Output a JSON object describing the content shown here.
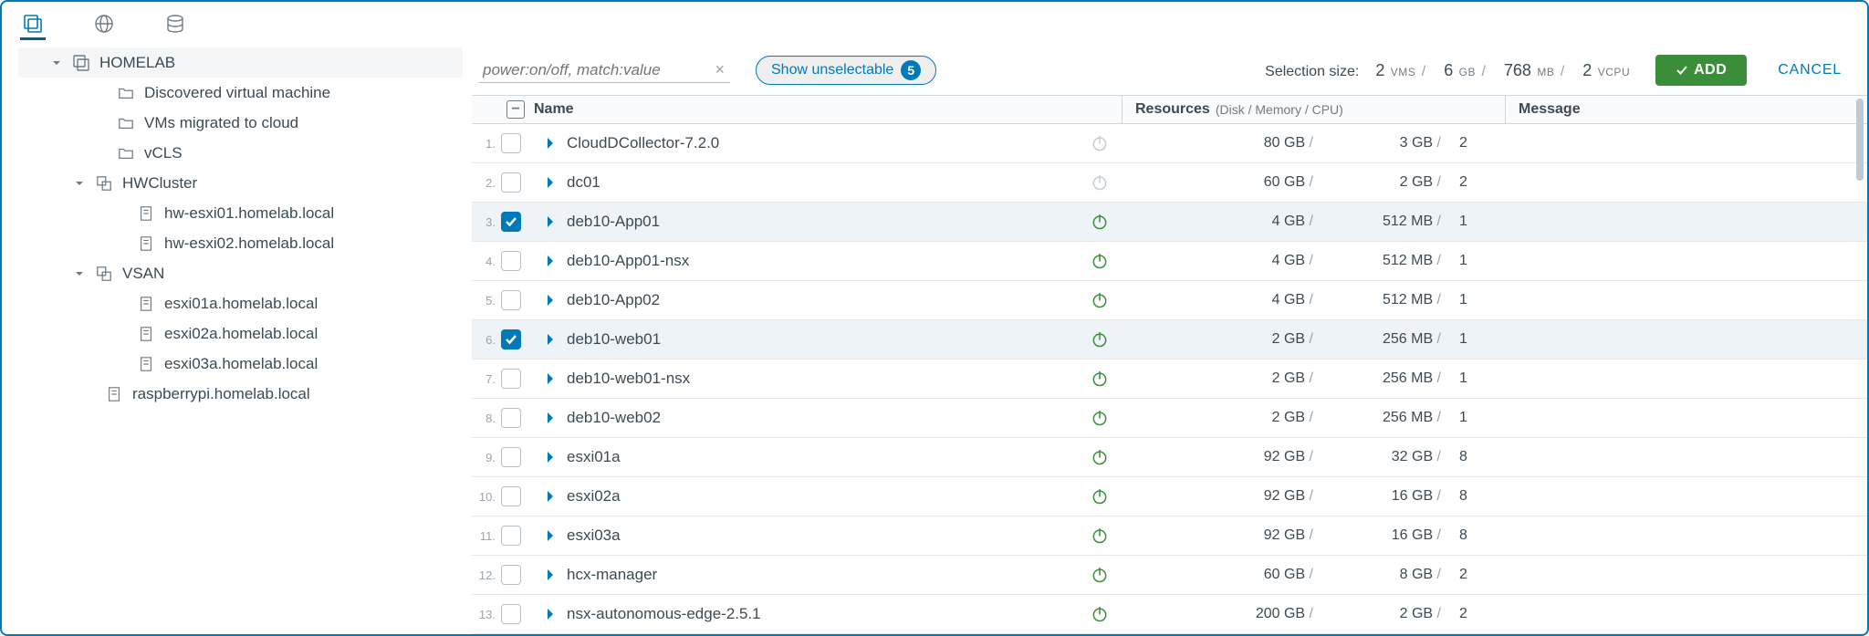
{
  "search": {
    "placeholder": "power:on/off, match:value"
  },
  "pill": {
    "label": "Show unselectable",
    "count": 5
  },
  "summary": {
    "label": "Selection size:",
    "vms": 2,
    "vms_unit": "VMS",
    "disk": 6,
    "disk_unit": "GB",
    "mem": 768,
    "mem_unit": "MB",
    "cpu": 2,
    "cpu_unit": "VCPU"
  },
  "buttons": {
    "add": "ADD",
    "cancel": "CANCEL"
  },
  "columns": {
    "name": "Name",
    "resources": "Resources",
    "resources_sub": "(Disk / Memory / CPU)",
    "message": "Message"
  },
  "tree": {
    "root": "HOMELAB",
    "folders": [
      "Discovered virtual machine",
      "VMs migrated to cloud",
      "vCLS"
    ],
    "clusters": [
      {
        "name": "HWCluster",
        "hosts": [
          "hw-esxi01.homelab.local",
          "hw-esxi02.homelab.local"
        ]
      },
      {
        "name": "VSAN",
        "hosts": [
          "esxi01a.homelab.local",
          "esxi02a.homelab.local",
          "esxi03a.homelab.local"
        ]
      }
    ],
    "lonehost": "raspberrypi.homelab.local"
  },
  "rows": [
    {
      "n": "1.",
      "name": "CloudDCollector-7.2.0",
      "disk": "80 GB",
      "mem": "3 GB",
      "cpu": "2",
      "power": "off",
      "checked": false
    },
    {
      "n": "2.",
      "name": "dc01",
      "disk": "60 GB",
      "mem": "2 GB",
      "cpu": "2",
      "power": "off",
      "checked": false
    },
    {
      "n": "3.",
      "name": "deb10-App01",
      "disk": "4 GB",
      "mem": "512 MB",
      "cpu": "1",
      "power": "on",
      "checked": true
    },
    {
      "n": "4.",
      "name": "deb10-App01-nsx",
      "disk": "4 GB",
      "mem": "512 MB",
      "cpu": "1",
      "power": "on",
      "checked": false
    },
    {
      "n": "5.",
      "name": "deb10-App02",
      "disk": "4 GB",
      "mem": "512 MB",
      "cpu": "1",
      "power": "on",
      "checked": false
    },
    {
      "n": "6.",
      "name": "deb10-web01",
      "disk": "2 GB",
      "mem": "256 MB",
      "cpu": "1",
      "power": "on",
      "checked": true
    },
    {
      "n": "7.",
      "name": "deb10-web01-nsx",
      "disk": "2 GB",
      "mem": "256 MB",
      "cpu": "1",
      "power": "on",
      "checked": false
    },
    {
      "n": "8.",
      "name": "deb10-web02",
      "disk": "2 GB",
      "mem": "256 MB",
      "cpu": "1",
      "power": "on",
      "checked": false
    },
    {
      "n": "9.",
      "name": "esxi01a",
      "disk": "92 GB",
      "mem": "32 GB",
      "cpu": "8",
      "power": "on",
      "checked": false
    },
    {
      "n": "10.",
      "name": "esxi02a",
      "disk": "92 GB",
      "mem": "16 GB",
      "cpu": "8",
      "power": "on",
      "checked": false
    },
    {
      "n": "11.",
      "name": "esxi03a",
      "disk": "92 GB",
      "mem": "16 GB",
      "cpu": "8",
      "power": "on",
      "checked": false
    },
    {
      "n": "12.",
      "name": "hcx-manager",
      "disk": "60 GB",
      "mem": "8 GB",
      "cpu": "2",
      "power": "on",
      "checked": false
    },
    {
      "n": "13.",
      "name": "nsx-autonomous-edge-2.5.1",
      "disk": "200 GB",
      "mem": "2 GB",
      "cpu": "2",
      "power": "on",
      "checked": false
    }
  ]
}
